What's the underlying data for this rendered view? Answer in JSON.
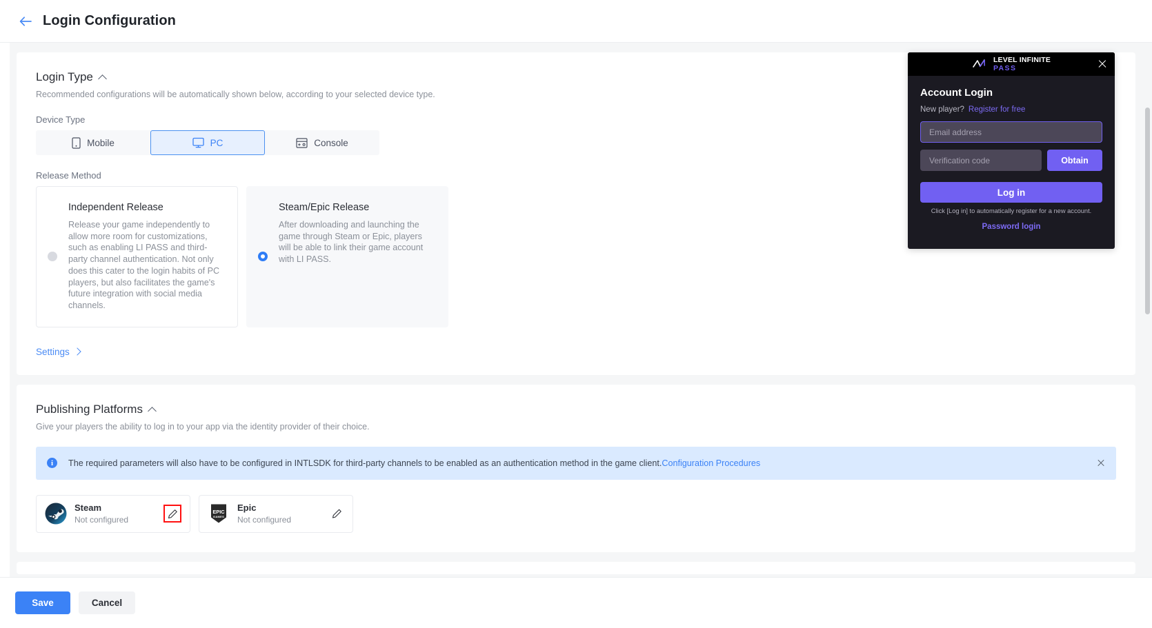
{
  "header": {
    "back_icon": "arrow-left-icon",
    "title": "Login Configuration"
  },
  "login_type": {
    "title": "Login Type",
    "subtitle": "Recommended configurations will be automatically shown below, according to your selected device type.",
    "device_type_label": "Device Type",
    "device_types": [
      {
        "label": "Mobile",
        "icon": "mobile-icon",
        "active": false
      },
      {
        "label": "PC",
        "icon": "desktop-icon",
        "active": true
      },
      {
        "label": "Console",
        "icon": "console-icon",
        "active": false
      }
    ],
    "release_method_label": "Release Method",
    "release_methods": [
      {
        "title": "Independent Release",
        "description": "Release your game independently to allow more room for customizations, such as enabling LI PASS and third-party channel authentication. Not only does this cater to the login habits of PC players, but also facilitates the game's future integration with social media channels.",
        "selected": false
      },
      {
        "title": "Steam/Epic Release",
        "description": "After downloading and launching the game through Steam or Epic, players will be able to link their game account with LI PASS.",
        "selected": true
      }
    ],
    "settings_link": "Settings"
  },
  "login_preview": {
    "brand_line1": "LEVEL INFINITE",
    "brand_line2": "PASS",
    "close_icon": "close-icon",
    "heading": "Account Login",
    "new_player_text": "New player?",
    "register_link": "Register for free",
    "email_placeholder": "Email address",
    "code_placeholder": "Verification code",
    "obtain_button": "Obtain",
    "login_button": "Log in",
    "hint": "Click [Log in] to automatically register for a new account.",
    "password_login_link": "Password login"
  },
  "publishing_platforms": {
    "title": "Publishing Platforms",
    "subtitle": "Give your players the ability to log in to your app via the identity provider of their choice.",
    "banner": {
      "icon": "info-icon",
      "text": "The required parameters will also have to be configured in INTLSDK for third-party channels to be enabled as an authentication method in the game client.",
      "link": "Configuration Procedures",
      "close_icon": "close-icon"
    },
    "tiles": [
      {
        "name": "Steam",
        "status": "Not configured",
        "logo": "steam-logo-icon",
        "edit_icon": "pencil-icon",
        "highlighted": true
      },
      {
        "name": "Epic",
        "status": "Not configured",
        "logo": "epic-games-logo-icon",
        "edit_icon": "pencil-icon",
        "highlighted": false
      }
    ]
  },
  "footer": {
    "save_label": "Save",
    "cancel_label": "Cancel"
  },
  "colors": {
    "accent_blue": "#3b82f6",
    "panel_purple": "#7160f2",
    "panel_dark": "#1b1a22",
    "banner_bg": "#daeaff",
    "highlight_red": "#ff0f0f"
  }
}
